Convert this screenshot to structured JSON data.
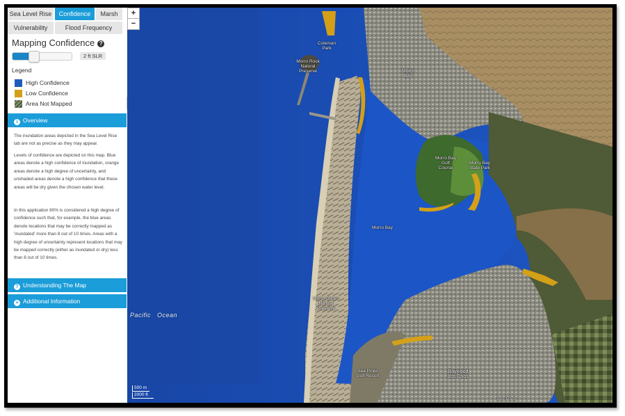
{
  "tabs": {
    "row1": [
      {
        "label": "Sea Level Rise",
        "active": false
      },
      {
        "label": "Confidence",
        "active": true
      },
      {
        "label": "Marsh",
        "active": false
      }
    ],
    "row2": [
      {
        "label": "Vulnerability",
        "active": false
      },
      {
        "label": "Flood Frequency",
        "active": false
      }
    ]
  },
  "panel": {
    "title": "Mapping Confidence",
    "help_icon": "question-circle-icon",
    "slider": {
      "value_fraction": 0.3,
      "label": "2 ft SLR"
    },
    "legend_title": "Legend",
    "legend": [
      {
        "label": "High Confidence",
        "color": "#1f5bbd"
      },
      {
        "label": "Low Confidence",
        "color": "#d4a017"
      },
      {
        "label": "Area Not Mapped",
        "color": "hatch"
      }
    ]
  },
  "sections": {
    "overview": {
      "label": "Overview",
      "icon": "info-icon",
      "paragraphs": [
        "The inundation areas depicted in the Sea Level Rise tab are not as precise as they may appear.",
        "Levels of confidence are depicted on this map. Blue areas denote a high confidence of inundation, orange areas denote a high degree of uncertainty, and unshaded areas denote a high confidence that these areas will be dry given the chosen water level.",
        "In this application 80% is considered a high degree of confidence such that, for example, the blue areas denote locations that may be correctly mapped as 'inundated' more than 8 out of 10 times. Areas with a high degree of uncertainty represent locations that may be mapped correctly (either as inundated or dry) less than 8 out of 10 times."
      ]
    },
    "understanding": {
      "label": "Understanding The Map",
      "icon": "question-icon"
    },
    "additional": {
      "label": "Additional Information",
      "icon": "plus-icon"
    }
  },
  "map": {
    "zoom_in": "+",
    "zoom_out": "−",
    "ocean_label": "Pacific   Ocean",
    "place_labels": [
      {
        "text": "Coleman Park",
        "name": "label-coleman-park"
      },
      {
        "text": "Morro Rock Natural Preserve",
        "name": "label-morro-rock"
      },
      {
        "text": "Morro Bay",
        "name": "label-morro-bay-city"
      },
      {
        "text": "Morro Bay Golf Course",
        "name": "label-golf-course"
      },
      {
        "text": "Morro Bay State Park",
        "name": "label-state-park"
      },
      {
        "text": "Morro Bay",
        "name": "label-morro-bay-water"
      },
      {
        "text": "Morro Dunes Natural Preserve",
        "name": "label-morro-dunes"
      },
      {
        "text": "Sea Pines Golf Resort",
        "name": "label-sea-pines"
      },
      {
        "text": "Baywood Los Osos",
        "name": "label-baywood"
      },
      {
        "text": "Los Osos",
        "name": "label-los-osos"
      }
    ],
    "scale": {
      "m": "500 m",
      "ft": "2000 ft"
    }
  }
}
